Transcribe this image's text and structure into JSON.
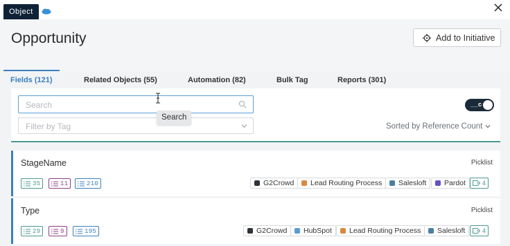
{
  "window": {
    "badge": "Object",
    "title": "Opportunity",
    "add_button": "Add to Initiative"
  },
  "tabs": [
    {
      "label": "Fields (121)",
      "active": true
    },
    {
      "label": "Related Objects (55)",
      "active": false
    },
    {
      "label": "Automation (82)",
      "active": false
    },
    {
      "label": "Bulk Tag",
      "active": false
    },
    {
      "label": "Reports (301)",
      "active": false
    }
  ],
  "filters": {
    "search_placeholder": "Search",
    "tag_placeholder": "Filter by Tag",
    "toggle_label": "__c",
    "toggle_on": true,
    "sort_label": "Sorted by Reference Count"
  },
  "tooltip": "Search",
  "colors": {
    "accent": "#3a7fc1",
    "teal": "#4a9990",
    "purple": "#8e3c86",
    "dark": "#0f2236"
  },
  "fields": [
    {
      "name": "StageName",
      "type": "Picklist",
      "counts": [
        "35",
        "11",
        "210"
      ],
      "chips": [
        {
          "label": "G2Crowd",
          "color": "#2d3338"
        },
        {
          "label": "Lead Routing Process",
          "color": "#d9893f"
        },
        {
          "label": "Salesloft",
          "color": "#4a7fa3"
        },
        {
          "label": "Pardot",
          "color": "#6a4fc4"
        }
      ],
      "tag_count": "4"
    },
    {
      "name": "Type",
      "type": "Picklist",
      "counts": [
        "29",
        "9",
        "195"
      ],
      "chips": [
        {
          "label": "G2Crowd",
          "color": "#2d3338"
        },
        {
          "label": "HubSpot",
          "color": "#5b9bd5"
        },
        {
          "label": "Lead Routing Process",
          "color": "#d9893f"
        },
        {
          "label": "Salesloft",
          "color": "#4a7fa3"
        }
      ],
      "tag_count": "4"
    }
  ]
}
